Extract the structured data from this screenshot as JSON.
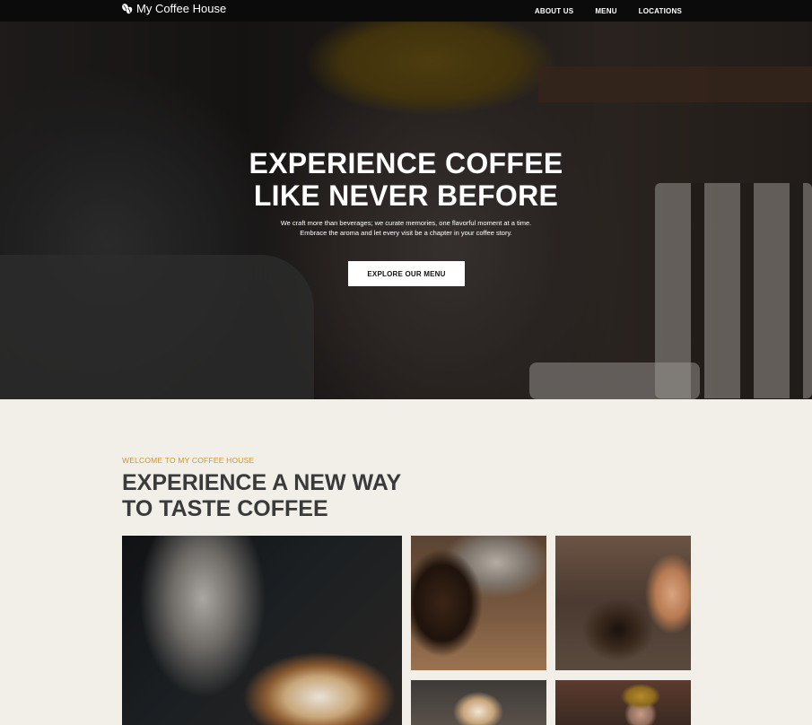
{
  "nav": {
    "brand": "My Coffee House",
    "links": [
      "ABOUT US",
      "MENU",
      "LOCATIONS"
    ]
  },
  "hero": {
    "title_line1": "EXPERIENCE COFFEE",
    "title_line2": "LIKE NEVER BEFORE",
    "subtitle": "We craft more than beverages; we curate memories, one flavorful moment at a time. Embrace the aroma and let every visit be a chapter in your coffee story.",
    "cta_label": "EXPLORE OUR MENU"
  },
  "about": {
    "eyebrow": "WELCOME TO MY COFFEE HOUSE",
    "title_line1": "EXPERIENCE A NEW WAY",
    "title_line2": "TO TASTE COFFEE"
  },
  "colors": {
    "nav_bg": "#0b0b0b",
    "page_bg": "#f2efe9",
    "accent": "#c9953b",
    "heading": "#3a3a3a"
  },
  "icons": {
    "brand": "coffee-beans-icon"
  }
}
